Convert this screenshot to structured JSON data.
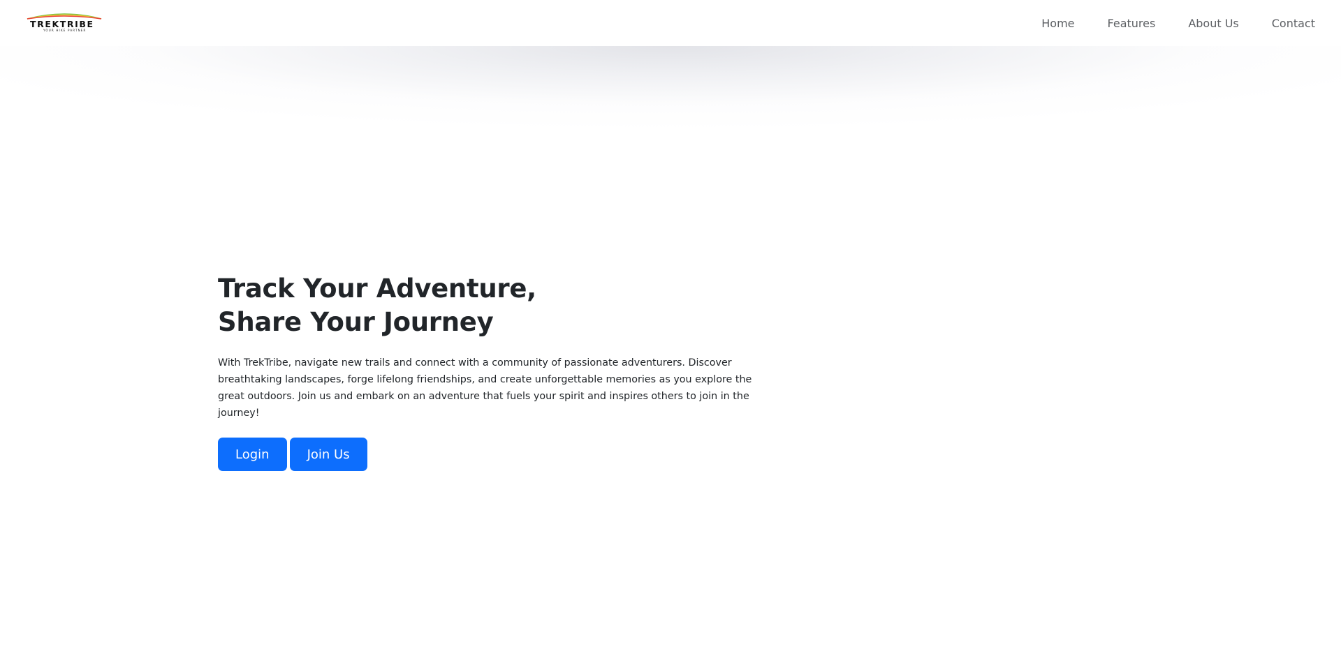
{
  "brand": {
    "name": "TREKTRIBE",
    "tagline": "YOUR HIKE PARTNER",
    "colors": {
      "green": "#7dc142",
      "yellow": "#f2c230",
      "red": "#e8453c"
    }
  },
  "nav": {
    "items": [
      {
        "label": "Home"
      },
      {
        "label": "Features"
      },
      {
        "label": "About Us"
      },
      {
        "label": "Contact"
      }
    ]
  },
  "hero": {
    "title_line1": "Track Your Adventure,",
    "title_line2": "Share Your Journey",
    "description": "With TrekTribe, navigate new trails and connect with a community of passionate adventurers. Discover breathtaking landscapes, forge lifelong friendships, and create unforgettable memories as you explore the great outdoors. Join us and embark on an adventure that fuels your spirit and inspires others to join in the journey!",
    "login_label": "Login",
    "join_label": "Join Us"
  },
  "theme": {
    "primary": "#0d6efd",
    "text": "#212529",
    "nav_text": "#5c5f63"
  }
}
